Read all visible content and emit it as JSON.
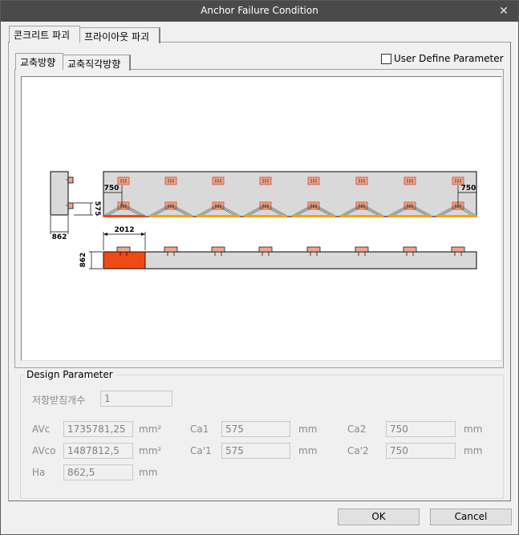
{
  "window": {
    "title": "Anchor Failure Condition",
    "close_glyph": "✕"
  },
  "outer_tabs": [
    {
      "label": "콘크리트 파괴",
      "selected": true
    },
    {
      "label": "프라이아웃 파괴",
      "selected": false
    }
  ],
  "inner_tabs": [
    {
      "label": "교축방향",
      "selected": true
    },
    {
      "label": "교축직각방향",
      "selected": false
    }
  ],
  "user_define": {
    "label": "User Define Parameter",
    "checked": false
  },
  "drawing": {
    "dim_section_width": "862",
    "dim_section_height": "575",
    "dim_left_edge": "750",
    "dim_right_edge": "750",
    "dim_elevation_width": "2012",
    "dim_elevation_height": "862",
    "colors": {
      "concrete": "#d9d9d9",
      "plate": "#f4a488",
      "highlight": "#f04a14",
      "cone_base": "#f5a500"
    }
  },
  "design_parameter": {
    "legend": "Design Parameter",
    "resist_label": "저항받침개수",
    "resist_value": "1",
    "avc_label": "AVc",
    "avc_value": "1735781,25",
    "avc_unit": "mm²",
    "avco_label": "AVco",
    "avco_value": "1487812,5",
    "avco_unit": "mm²",
    "ha_label": "Ha",
    "ha_value": "862,5",
    "ha_unit": "mm",
    "ca1_label": "Ca1",
    "ca1_value": "575",
    "ca1_unit": "mm",
    "ca1p_label": "Ca'1",
    "ca1p_value": "575",
    "ca1p_unit": "mm",
    "ca2_label": "Ca2",
    "ca2_value": "750",
    "ca2_unit": "mm",
    "ca2p_label": "Ca'2",
    "ca2p_value": "750",
    "ca2p_unit": "mm"
  },
  "buttons": {
    "ok": "OK",
    "cancel": "Cancel"
  }
}
